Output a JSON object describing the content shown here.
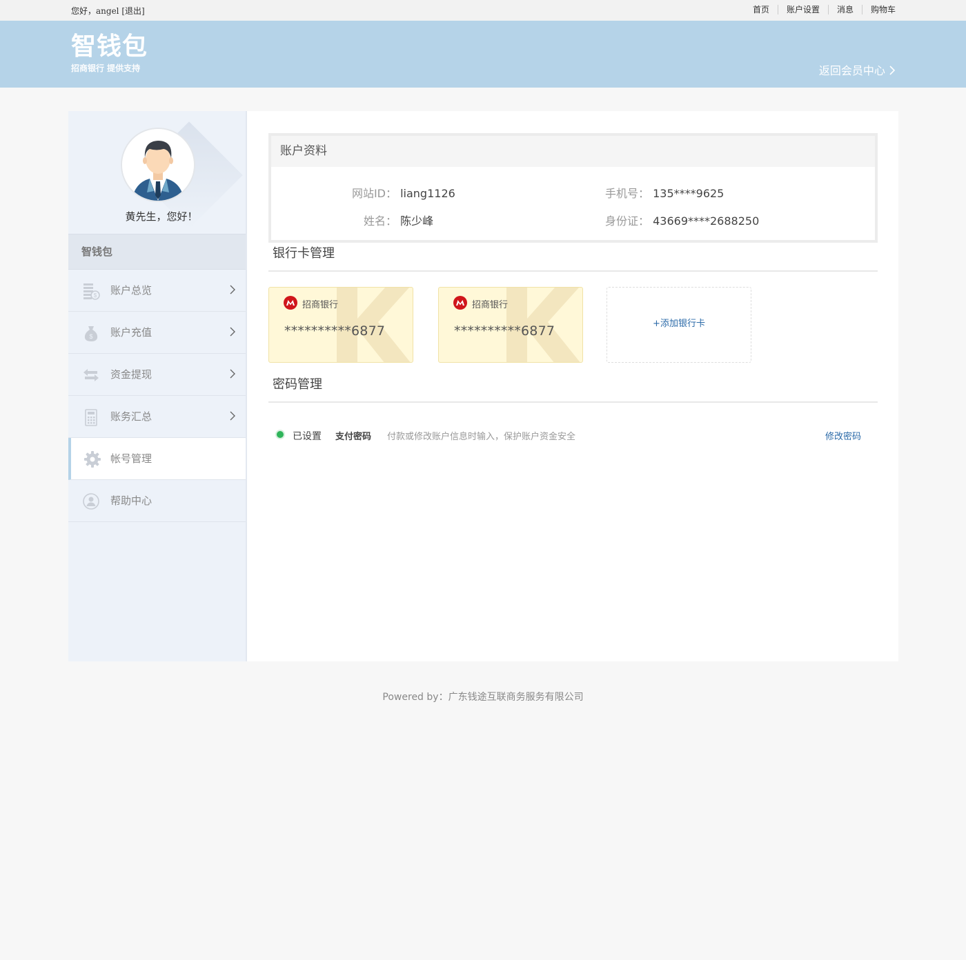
{
  "topbar": {
    "greeting": "您好，angel",
    "logout": "[退出]",
    "nav": [
      "首页",
      "账户设置",
      "消息",
      "购物车"
    ]
  },
  "header": {
    "brand": "智钱包",
    "brand_sub": "招商银行 提供支持",
    "back_link": "返回会员中心"
  },
  "sidebar": {
    "hello": "黄先生，您好！",
    "section_title": "智钱包",
    "items": [
      {
        "label": "账户总览",
        "icon": "coins-icon",
        "arrow": true
      },
      {
        "label": "账户充值",
        "icon": "money-bag-icon",
        "arrow": true
      },
      {
        "label": "资金提现",
        "icon": "transfer-icon",
        "arrow": true
      },
      {
        "label": "账务汇总",
        "icon": "calculator-icon",
        "arrow": true
      },
      {
        "label": "帐号管理",
        "icon": "gear-icon",
        "arrow": false,
        "active": true
      },
      {
        "label": "帮助中心",
        "icon": "help-icon",
        "arrow": false
      }
    ]
  },
  "account": {
    "title": "账户资料",
    "site_id_label": "网站ID：",
    "site_id": "liang1126",
    "phone_label": "手机号：",
    "phone": "135****9625",
    "name_label": "姓名：",
    "name": "陈少峰",
    "id_label": "身份证：",
    "id_no": "43669****2688250"
  },
  "bank": {
    "title": "银行卡管理",
    "cards": [
      {
        "bank": "招商银行",
        "number": "**********6877"
      },
      {
        "bank": "招商银行",
        "number": "**********6877"
      }
    ],
    "add_label": "+添加银行卡"
  },
  "password": {
    "title": "密码管理",
    "status": "已设置",
    "type": "支付密码",
    "desc": "付款或修改账户信息时输入，保护账户资金安全",
    "action": "修改密码"
  },
  "footer": "Powered by：广东钱途互联商务服务有限公司",
  "colors": {
    "header_bg": "#b5d3e8",
    "link": "#2b6aa8",
    "card_bg": "#fff8d8",
    "status_green": "#2fb45a"
  }
}
